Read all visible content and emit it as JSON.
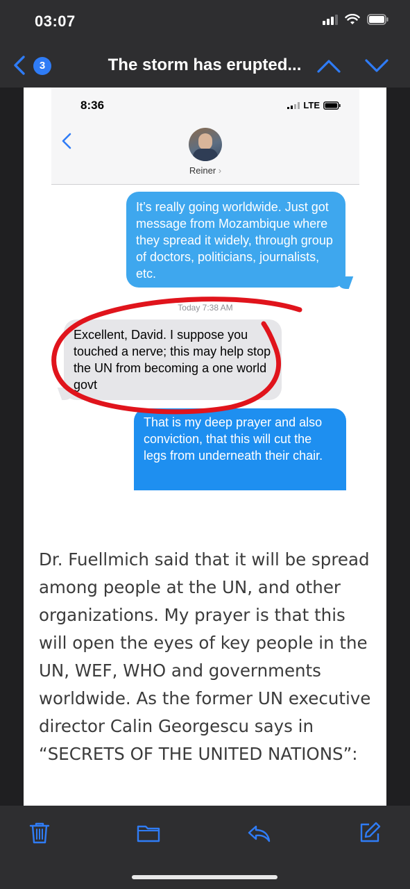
{
  "status_bar": {
    "time": "03:07",
    "icons": [
      "signal-icon",
      "wifi-icon",
      "battery-icon"
    ]
  },
  "nav": {
    "back_icon": "chevron-left-icon",
    "unread_count": "3",
    "title": "The storm has erupted...",
    "prev_icon": "chevron-up-icon",
    "next_icon": "chevron-down-icon"
  },
  "embedded_screenshot": {
    "time": "8:36",
    "carrier": "LTE",
    "contact_name": "Reiner",
    "messages": [
      {
        "sender": "me",
        "text": "It’s really going worldwide. Just got message from Mozambique where they spread it widely, through group of doctors, politicians, journalists, etc."
      },
      {
        "sender": "them",
        "text": "Excellent, David. I suppose you touched a nerve; this may help stop the UN from becoming a one world govt"
      },
      {
        "sender": "me",
        "text": "That is my deep prayer and also conviction, that this will cut the legs from underneath their chair."
      }
    ],
    "timestamp": "Today 7:38 AM",
    "highlight_color": "#e0141c"
  },
  "article": {
    "paragraph": "Dr. Fuellmich said that it will be spread among people at the UN, and other organizations. My prayer is that this will open the eyes of key people in the UN, WEF, WHO and governments worldwide. As the former UN executive director Calin Georgescu says in “SECRETS OF THE UNITED NATIONS”:"
  },
  "toolbar": {
    "icons": [
      "trash-icon",
      "folder-icon",
      "reply-icon",
      "compose-icon"
    ]
  },
  "colors": {
    "accent": "#2f7cf6",
    "bubble_blue": "#3ea7ee",
    "bubble_gray": "#e6e6e9"
  }
}
